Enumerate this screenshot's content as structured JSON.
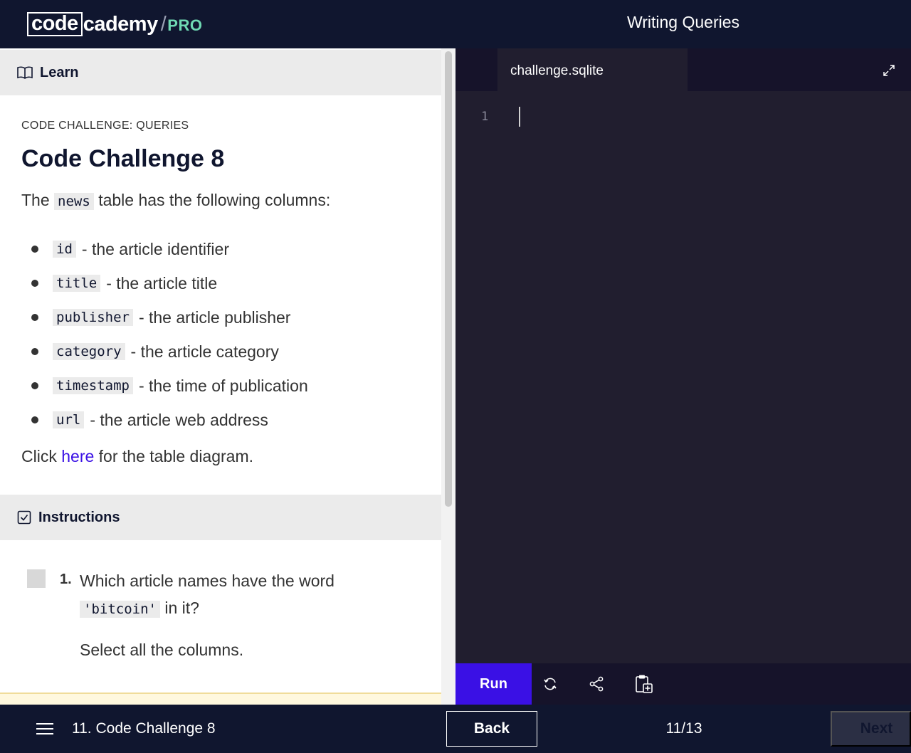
{
  "header": {
    "logo_box": "code",
    "logo_rest": "cademy",
    "logo_slash": "/",
    "logo_pro": "PRO",
    "title": "Writing Queries"
  },
  "learn": {
    "section_label": "Learn",
    "eyebrow": "CODE CHALLENGE: QUERIES",
    "heading": "Code Challenge 8",
    "intro_before": "The",
    "intro_code": "news",
    "intro_after": "table has the following columns:",
    "columns": [
      {
        "name": "id",
        "desc": "- the article identifier"
      },
      {
        "name": "title",
        "desc": "- the article title"
      },
      {
        "name": "publisher",
        "desc": "- the article publisher"
      },
      {
        "name": "category",
        "desc": "- the article category"
      },
      {
        "name": "timestamp",
        "desc": "- the time of publication"
      },
      {
        "name": "url",
        "desc": "- the article web address"
      }
    ],
    "diagram_before": "Click",
    "diagram_link": "here",
    "diagram_after": "for the table diagram."
  },
  "instructions": {
    "section_label": "Instructions",
    "task_number": "1.",
    "task_line1": "Which article names have the word",
    "task_code": "'bitcoin'",
    "task_line2_after": "in it?",
    "task_line3": "Select all the columns."
  },
  "editor": {
    "tab_name": "challenge.sqlite",
    "line_number": "1"
  },
  "toolbar": {
    "run_label": "Run"
  },
  "footer": {
    "lesson_name": "11. Code Challenge 8",
    "back_label": "Back",
    "progress": "11/13",
    "next_label": "Next"
  },
  "colors": {
    "navy": "#10162f",
    "accent": "#3a10e5",
    "editor_bg": "#211e2f",
    "pro_green": "#6fd9b3"
  }
}
